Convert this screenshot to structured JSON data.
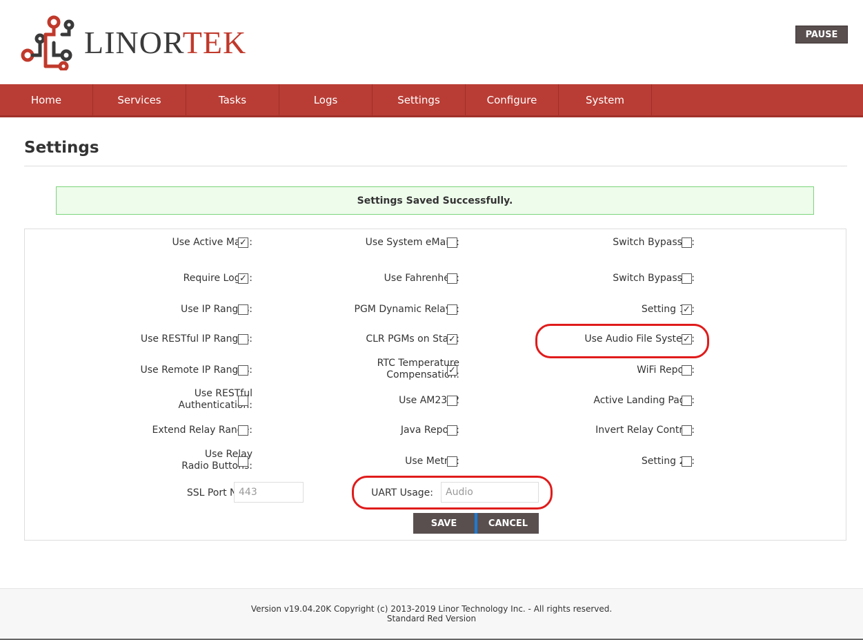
{
  "header": {
    "logo_text_dark": "LINOR",
    "logo_text_red": "TEK",
    "pause_label": "PAUSE"
  },
  "nav": {
    "items": [
      {
        "label": "Home"
      },
      {
        "label": "Services"
      },
      {
        "label": "Tasks"
      },
      {
        "label": "Logs"
      },
      {
        "label": "Settings"
      },
      {
        "label": "Configure"
      },
      {
        "label": "System"
      }
    ]
  },
  "page": {
    "title": "Settings",
    "alert": "Settings Saved Successfully."
  },
  "settings": {
    "col1": [
      {
        "label": "Use Active Main:",
        "checked": true
      },
      {
        "label": "Require Login:",
        "checked": true
      },
      {
        "label": "Use IP Ranges:",
        "checked": false
      },
      {
        "label": "Use RESTful IP Ranges:",
        "checked": false
      },
      {
        "label": "Use Remote IP Ranges:",
        "checked": false
      },
      {
        "label": "Use RESTful Authentication:",
        "checked": false
      },
      {
        "label": "Extend Relay Range:",
        "checked": false
      },
      {
        "label": "Use Relay Radio Buttons:",
        "checked": false
      }
    ],
    "col2": [
      {
        "label": "Use System eMails:",
        "checked": false
      },
      {
        "label": "Use Fahrenheit:",
        "checked": false
      },
      {
        "label": "PGM Dynamic Relays:",
        "checked": false
      },
      {
        "label": "CLR PGMs on Start:",
        "checked": true
      },
      {
        "label": "RTC Temperature Compensation:",
        "checked": true
      },
      {
        "label": "Use AM2302",
        "checked": false
      },
      {
        "label": "Java Report:",
        "checked": false
      },
      {
        "label": "Use Metric:",
        "checked": false
      }
    ],
    "col3": [
      {
        "label": "Switch Bypass 1:",
        "checked": false
      },
      {
        "label": "Switch Bypass 2:",
        "checked": false
      },
      {
        "label": "Setting 19:",
        "checked": true
      },
      {
        "label": "Use Audio File System:",
        "checked": true
      },
      {
        "label": "WiFi Report:",
        "checked": false
      },
      {
        "label": "Active Landing Page:",
        "checked": false
      },
      {
        "label": "Invert Relay Control:",
        "checked": false
      },
      {
        "label": "Setting 24:",
        "checked": false
      }
    ],
    "ssl_label": "SSL Port No.:",
    "ssl_value": "443",
    "uart_label": "UART Usage:",
    "uart_value": "Audio",
    "save_label": "SAVE",
    "cancel_label": "CANCEL"
  },
  "footer": {
    "line1": "Version v19.04.20K Copyright (c) 2013-2019 Linor Technology Inc. - All rights reserved.",
    "line2": "Standard Red Version"
  },
  "colors": {
    "nav_red": "#b93d35",
    "button_dark": "#5a4f4f",
    "alert_bg": "#eefcec",
    "alert_border": "#7bd37a",
    "annotation_red": "#e01b1b"
  }
}
